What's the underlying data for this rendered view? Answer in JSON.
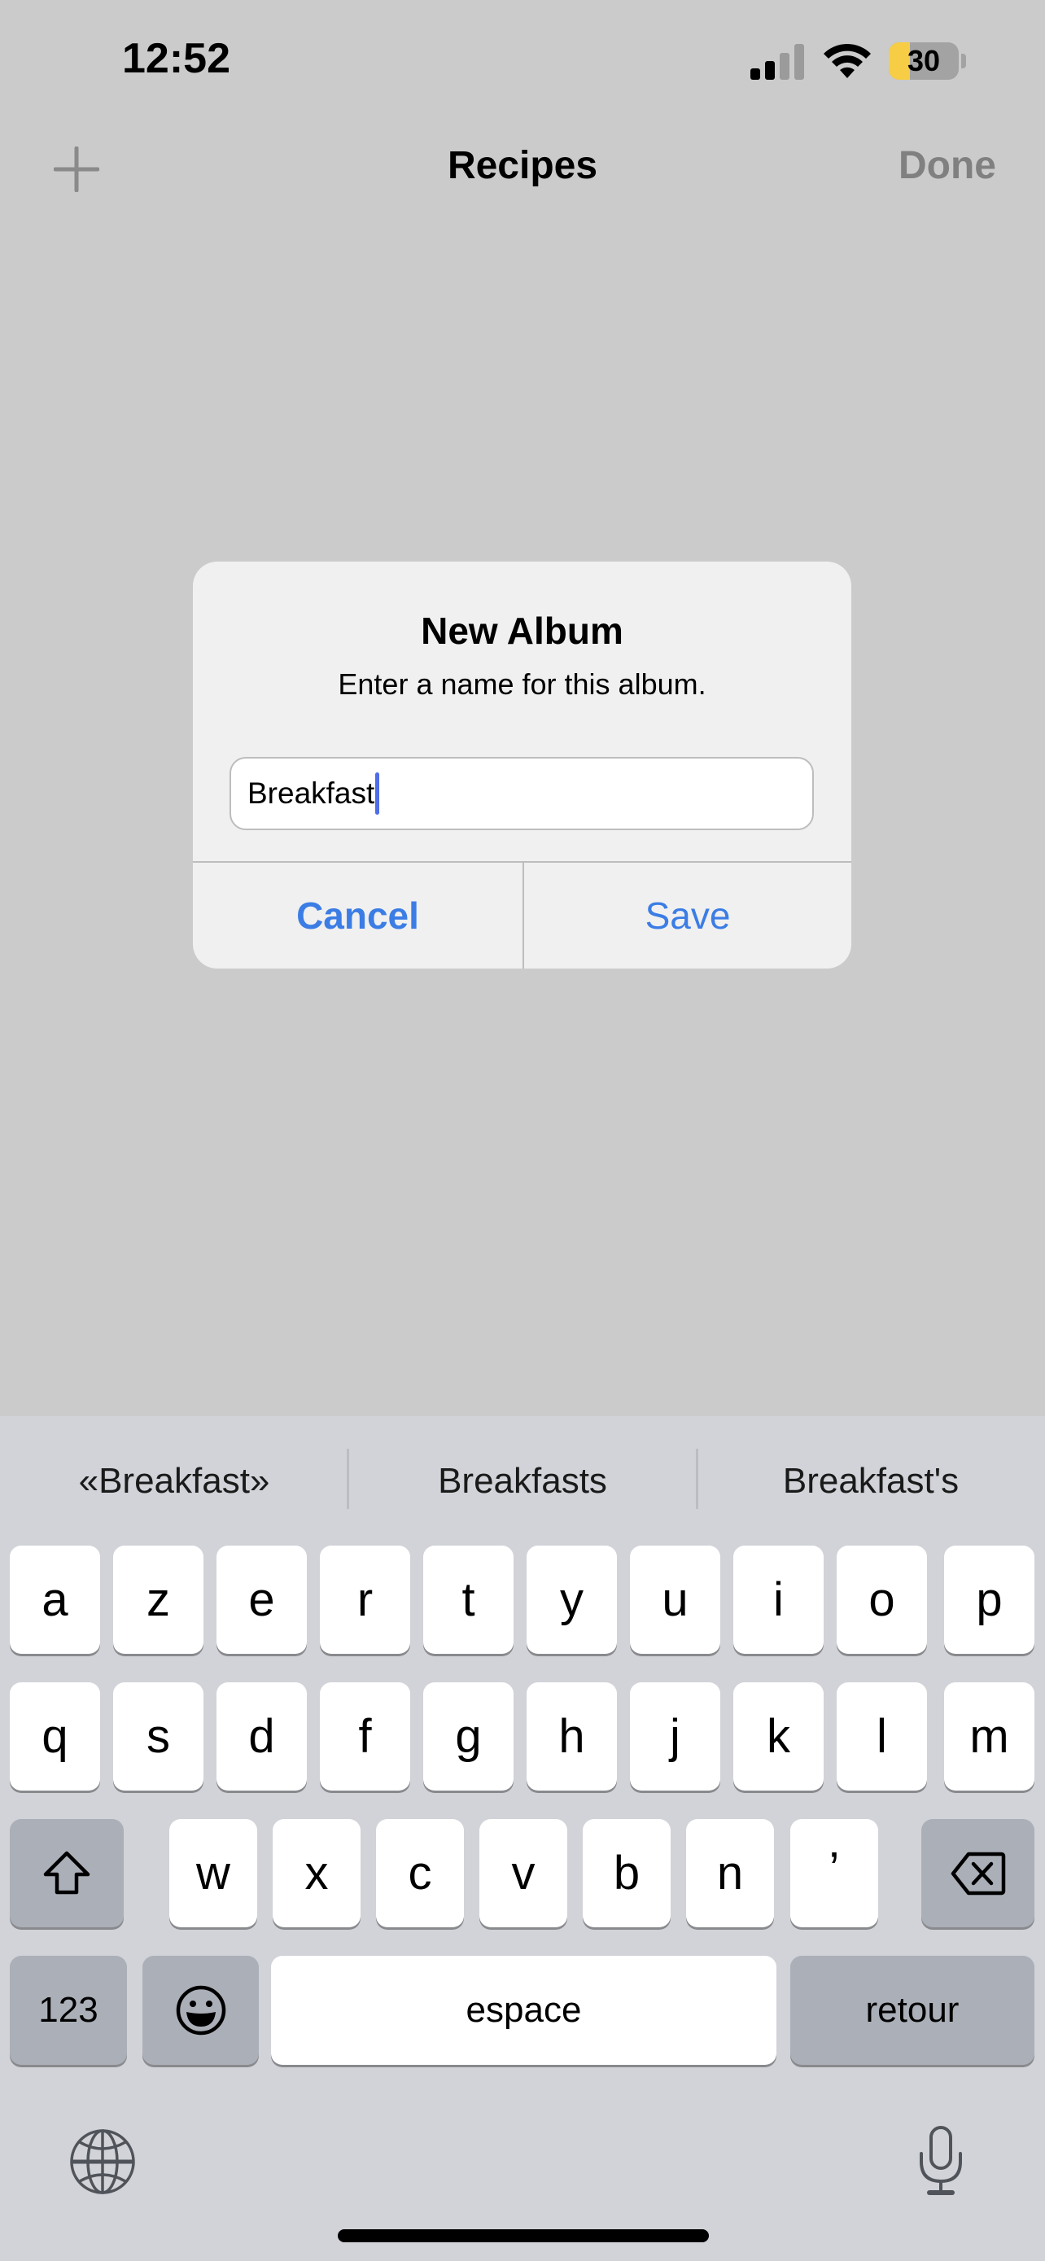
{
  "status_bar": {
    "time": "12:52",
    "signal_bars_active": 2,
    "signal_bars_total": 4,
    "battery_percent": 30,
    "battery_label": "30",
    "battery_color": "#f6cd45"
  },
  "nav": {
    "add_icon": "plus-icon",
    "title": "Recipes",
    "done_label": "Done"
  },
  "dialog": {
    "title": "New Album",
    "message": "Enter a name for this album.",
    "field_value": "Breakfast",
    "cancel_label": "Cancel",
    "save_label": "Save",
    "accent_color": "#3b7de5"
  },
  "keyboard": {
    "suggestions": [
      "«Breakfast»",
      "Breakfasts",
      "Breakfast's"
    ],
    "row1": [
      "a",
      "z",
      "e",
      "r",
      "t",
      "y",
      "u",
      "i",
      "o",
      "p"
    ],
    "row2": [
      "q",
      "s",
      "d",
      "f",
      "g",
      "h",
      "j",
      "k",
      "l",
      "m"
    ],
    "row3": [
      "w",
      "x",
      "c",
      "v",
      "b",
      "n",
      "’"
    ],
    "shift_icon": "shift-icon",
    "delete_icon": "delete-icon",
    "numbers_label": "123",
    "emoji_icon": "emoji-icon",
    "space_label": "espace",
    "return_label": "retour",
    "globe_icon": "globe-icon",
    "mic_icon": "microphone-icon"
  }
}
